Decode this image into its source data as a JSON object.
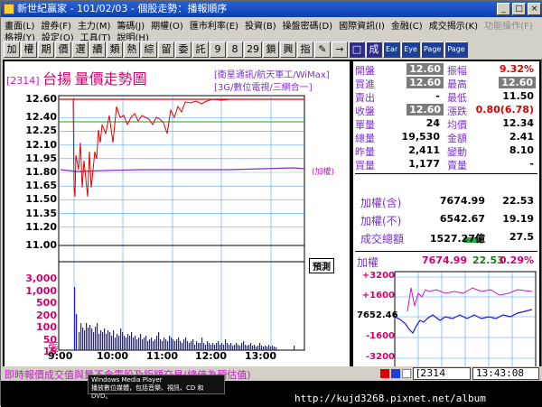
{
  "window": {
    "title": "新世紀贏家 - 101/02/03 - 個股走勢：播報順序",
    "controls": [
      "_",
      "□",
      "×"
    ]
  },
  "menu": {
    "row1": [
      "畫面(L)",
      "證券(F)",
      "主力(M)",
      "籌碼(J)",
      "期權(O)",
      "匯市利率(E)",
      "投資(B)",
      "操盤密碼(D)",
      "國際資訊(I)",
      "金融(C)",
      "成交揭示(K)",
      "功能操作(F)"
    ],
    "row2": [
      "格視(Y)",
      "設定(O)",
      "工具(T)",
      "說明(H)"
    ]
  },
  "toolbar": {
    "buttons": [
      "加",
      "權",
      "期",
      "價",
      "選",
      "續",
      "類",
      "熱",
      "綜",
      "留",
      "委",
      "託",
      "9",
      "8",
      "29",
      "鎖",
      "興",
      "指",
      "✎",
      "→",
      "□",
      "成",
      "Ear",
      "Eye",
      "Page\nDn",
      "Page\nUp"
    ]
  },
  "chart": {
    "code": "[2314]",
    "name": "台揚",
    "title": "量價走勢圖",
    "sub1": "[衛星通訊/航天軍工/WiMax]",
    "sub2": "[3G/數位電視/三網合一]",
    "add_weight": "(加權)",
    "price_marker": "預測",
    "vol_unit": "張",
    "yticks": [
      "12.60",
      "12.40",
      "12.25",
      "12.10",
      "11.95",
      "11.80",
      "11.65",
      "11.50",
      "11.35",
      "11.20",
      "11.00"
    ],
    "vticks": [
      "3,000",
      "1,000",
      "500",
      "200",
      "100",
      "50",
      "15"
    ],
    "xticks": [
      "9:00",
      "10:00",
      "11:00",
      "12:00",
      "13:00"
    ]
  },
  "chart_data": {
    "type": "line",
    "title": "量價走勢圖",
    "ylim": [
      11.0,
      12.6
    ],
    "ref_price": 11.8,
    "x": [
      "9:00",
      "10:00",
      "11:00",
      "12:00",
      "13:00"
    ],
    "ylabel": "",
    "xlabel": ""
  },
  "quote": {
    "rows": [
      {
        "k": "開盤",
        "v": "12.60",
        "k2": "振幅",
        "v2": "9.32%"
      },
      {
        "k": "買進",
        "v": "12.60",
        "k2": "最高",
        "v2": "12.60"
      },
      {
        "k": "賣出",
        "v": "-",
        "k2": "最低",
        "v2": "11.50"
      },
      {
        "k": "收盤",
        "v": "12.60",
        "k2": "漲跌",
        "v2": "0.80(6.78)"
      },
      {
        "k": "單量",
        "v": "24",
        "k2": "均價",
        "v2": "12.34"
      },
      {
        "k": "總量",
        "v": "19,530",
        "k2": "金額",
        "v2": "2.41"
      },
      {
        "k": "昨量",
        "v": "2,411",
        "k2": "變動",
        "v2": "8.10"
      },
      {
        "k": "買量",
        "v": "1,177",
        "k2": "賣量",
        "v2": "-"
      }
    ]
  },
  "index": {
    "rows": [
      {
        "k": "加權(含)",
        "v": "7674.99",
        "c": "22.53"
      },
      {
        "k": "加權(不)",
        "v": "6542.67",
        "c": "19.19"
      },
      {
        "k": "成交總額",
        "v": "1527.27億",
        "c": "27.5"
      }
    ],
    "mini_label": "加權",
    "mini_value": "7674.99",
    "mini_change": "22.53",
    "mini_pct": "0.29%",
    "mini_ticks": [
      "+3200",
      "+1600",
      "7652.46",
      "-1600",
      "-3200"
    ]
  },
  "status": {
    "text": "即時報價成交值與量不含零股及鉅額交易(總值為預估值)",
    "code": "[2314",
    "time": "13:43:08"
  },
  "taskbar": {
    "tooltip1": "Windows Media Player",
    "tooltip2": "播放數位媒體，包括音樂、視訊、CD 和 DVD。",
    "url": "http://kujd3268.pixnet.net/album"
  }
}
